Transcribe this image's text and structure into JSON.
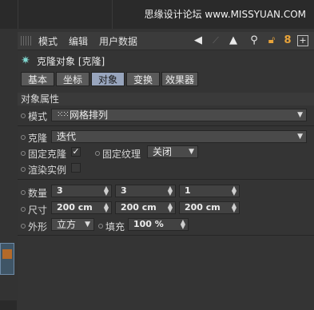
{
  "watermark": "思缘设计论坛 www.MISSYUAN.COM",
  "menu": {
    "items": [
      "模式",
      "编辑",
      "用户数据"
    ]
  },
  "object": {
    "title": "克隆对象 [克隆]"
  },
  "tabs": [
    "基本",
    "坐标",
    "对象",
    "变换",
    "效果器"
  ],
  "section_title": "对象属性",
  "mode": {
    "label": "模式",
    "value": "网格排列"
  },
  "clone": {
    "label": "克隆",
    "value": "迭代"
  },
  "fixed_clone": {
    "label": "固定克隆",
    "checked": true
  },
  "fixed_texture": {
    "label": "固定纹理",
    "value": "关闭"
  },
  "render_instance": {
    "label": "渲染实例",
    "checked": false
  },
  "count": {
    "label": "数量",
    "values": [
      "3",
      "3",
      "1"
    ]
  },
  "size": {
    "label": "尺寸",
    "values": [
      "200 cm",
      "200 cm",
      "200 cm"
    ]
  },
  "shape": {
    "label": "外形",
    "value": "立方"
  },
  "fill": {
    "label": "填充",
    "value": "100 %"
  },
  "colors": {
    "accent_lock": "#e8a33a",
    "active_tab": "#98a5bd"
  }
}
